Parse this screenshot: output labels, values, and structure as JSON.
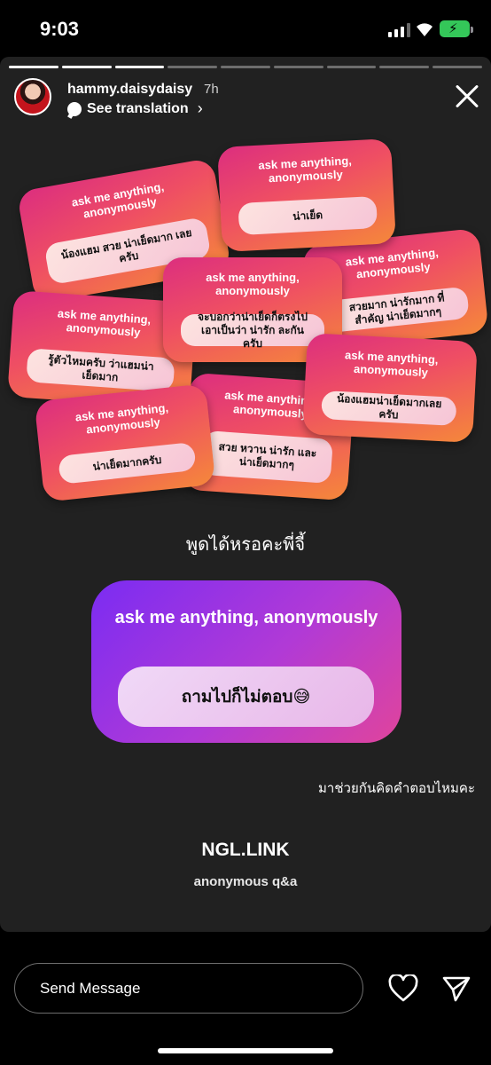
{
  "status": {
    "time": "9:03"
  },
  "story": {
    "progress_segments": [
      1,
      1,
      1,
      0,
      0,
      0,
      0,
      0,
      0
    ],
    "username": "hammy.daisydaisy",
    "age": "7h",
    "see_translation": "See translation",
    "cards": [
      {
        "question": "ask me anything, anonymously",
        "answer": "น้องแฮม สวย น่าเย็ดมาก เลยครับ"
      },
      {
        "question": "ask me anything, anonymously",
        "answer": "น่าเย็ด"
      },
      {
        "question": "ask me anything, anonymously",
        "answer": "สวยมาก น่ารักมาก ที่สำคัญ น่าเย็ดมากๆ"
      },
      {
        "question": "ask me anything, anonymously",
        "answer": "จะบอกว่าน่าเย็ดก็ตรงไป เอาเป็นว่า น่ารัก ละกันครับ"
      },
      {
        "question": "ask me anything, anonymously",
        "answer": "รู้ตัวไหมครับ ว่าแฮมน่า เย็ดมาก"
      },
      {
        "question": "ask me anything, anonymously",
        "answer": "น้องแฮมน่าเย็ดมากเลยครับ"
      },
      {
        "question": "ask me anything, anonymously",
        "answer": "สวย หวาน น่ารัก และน่าเย็ดมากๆ"
      },
      {
        "question": "ask me anything, anonymously",
        "answer": "น่าเย็ดมากครับ"
      }
    ],
    "caption_top": "พูดได้หรอคะพี่จี้",
    "main_card": {
      "question": "ask me anything, anonymously",
      "answer": "ถามไปก็ไม่ตอบ😅"
    },
    "caption_bottom": "มาช่วยกันคิดคำตอบไหมคะ",
    "brand": "NGL.LINK",
    "brand_sub": "anonymous q&a"
  },
  "reply": {
    "placeholder": "Send Message",
    "like_icon": "heart-icon",
    "send_icon": "paper-plane-icon"
  }
}
